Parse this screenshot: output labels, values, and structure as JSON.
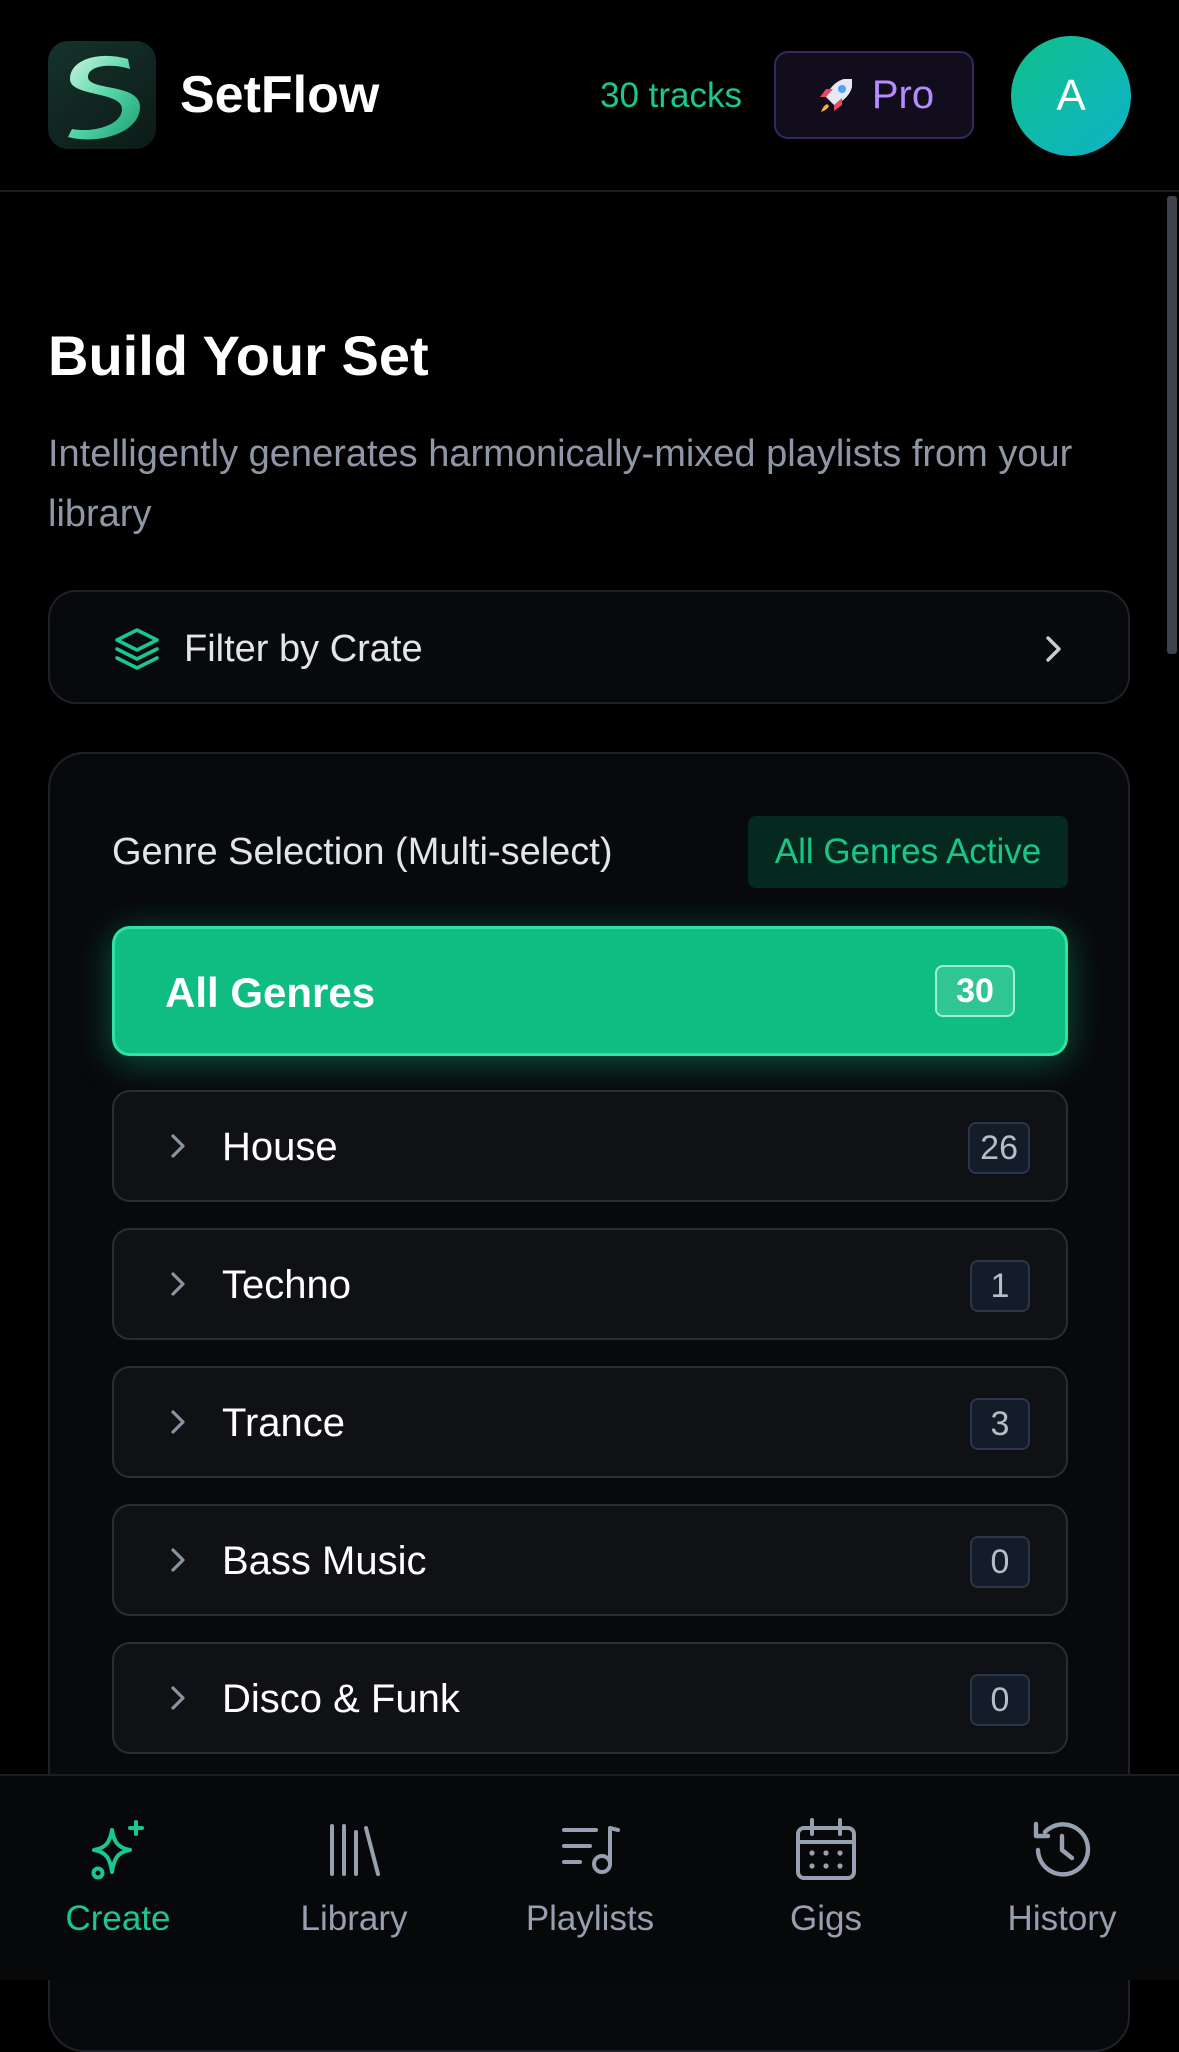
{
  "header": {
    "app_name": "SetFlow",
    "tracks_count": "30 tracks",
    "pro_label": "Pro",
    "avatar_initial": "A",
    "pro_icon": "rocket-icon"
  },
  "main": {
    "title": "Build Your Set",
    "subtitle": "Intelligently generates harmonically-mixed playlists from your library",
    "filter": {
      "label": "Filter by Crate",
      "icon": "layers-icon"
    },
    "genres": {
      "heading": "Genre Selection (Multi-select)",
      "active_badge": "All Genres Active",
      "all": {
        "label": "All Genres",
        "count": "30",
        "selected": true
      },
      "items": [
        {
          "label": "House",
          "count": "26"
        },
        {
          "label": "Techno",
          "count": "1"
        },
        {
          "label": "Trance",
          "count": "3"
        },
        {
          "label": "Bass Music",
          "count": "0"
        },
        {
          "label": "Disco & Funk",
          "count": "0"
        }
      ]
    }
  },
  "nav": {
    "active": "Create",
    "items": [
      {
        "label": "Create",
        "icon": "sparkles-icon"
      },
      {
        "label": "Library",
        "icon": "library-icon"
      },
      {
        "label": "Playlists",
        "icon": "playlist-icon"
      },
      {
        "label": "Gigs",
        "icon": "calendar-icon"
      },
      {
        "label": "History",
        "icon": "history-icon"
      }
    ]
  },
  "colors": {
    "accent": "#10bd84",
    "accent_text": "#19c88e",
    "pro_purple": "#b48cff",
    "background": "#000000",
    "muted_text": "#8f97a6"
  }
}
